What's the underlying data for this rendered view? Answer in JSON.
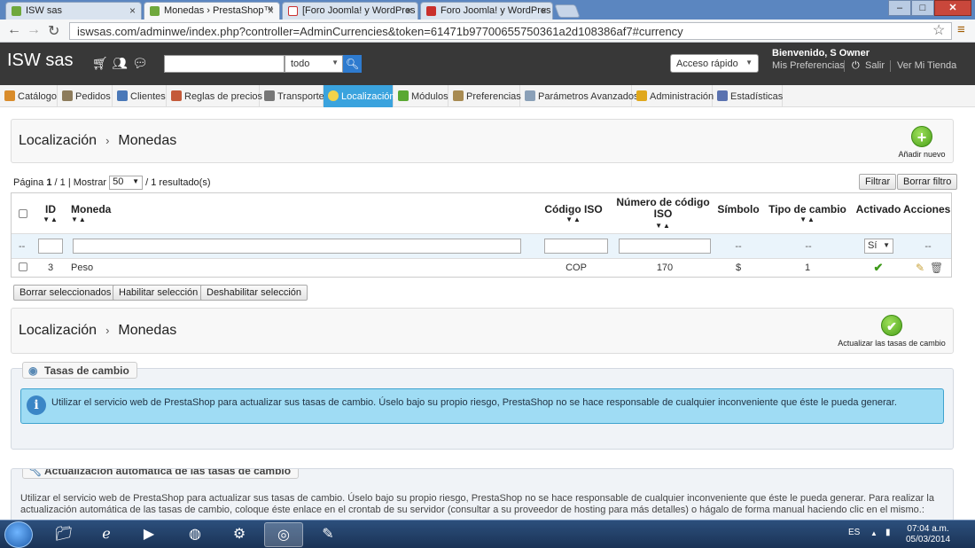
{
  "browser": {
    "tabs": [
      {
        "label": "ISW sas",
        "active": false
      },
      {
        "label": "Monedas › PrestaShop™",
        "active": true
      },
      {
        "label": "[Foro Joomla! y WordPres",
        "active": false
      },
      {
        "label": "Foro Joomla! y WordPres",
        "active": false
      }
    ],
    "window_buttons": {
      "minimize": "–",
      "maximize": "□",
      "close": "✕"
    },
    "url": "iswsas.com/adminwe/index.php?controller=AdminCurrencies&token=61471b97700655750361a2d108386af7#currency",
    "colors": {
      "tabbar": "#5b86c0",
      "accent": "#3aa3de"
    }
  },
  "header": {
    "shop_name": "ISW sas",
    "search_placeholder": "",
    "search_scope": "todo",
    "quick_access": "Acceso rápido",
    "welcome": "Bienvenido, S Owner",
    "prefs_link": "Mis Preferencias",
    "logout_link": "Salir",
    "store_link": "Ver Mi Tienda"
  },
  "menu": {
    "items": [
      {
        "label": "Catálogo",
        "icon": "catalog-icon",
        "color": "#d98c2b"
      },
      {
        "label": "Pedidos",
        "icon": "orders-icon",
        "color": "#8d7c5c"
      },
      {
        "label": "Clientes",
        "icon": "customers-icon",
        "color": "#4a78b8"
      },
      {
        "label": "Reglas de precios",
        "icon": "price-rules-icon",
        "color": "#c45a3a"
      },
      {
        "label": "Transporte",
        "icon": "shipping-icon",
        "color": "#777777"
      },
      {
        "label": "Localización",
        "icon": "localization-icon",
        "color": "#f2d34a"
      },
      {
        "label": "Módulos",
        "icon": "modules-icon",
        "color": "#5aa832"
      },
      {
        "label": "Preferencias",
        "icon": "preferences-icon",
        "color": "#a88b52"
      },
      {
        "label": "Parámetros Avanzados",
        "icon": "advanced-icon",
        "color": "#8aa0b8"
      },
      {
        "label": "Administración",
        "icon": "admin-icon",
        "color": "#e0a81c"
      },
      {
        "label": "Estadísticas",
        "icon": "stats-icon",
        "color": "#5a72b0"
      }
    ]
  },
  "toolbar1": {
    "crumb_1": "Localización",
    "crumb_sep": "›",
    "crumb_2": "Monedas",
    "add_new": "Añadir nuevo"
  },
  "list": {
    "page_label": "Página",
    "page_current": "1",
    "page_total": "/ 1",
    "show_label": "| Mostrar",
    "show_value": "50",
    "results": "/ 1 resultado(s)",
    "filter_btn": "Filtrar",
    "reset_btn": "Borrar filtro",
    "columns": {
      "id": "ID",
      "currency": "Moneda",
      "iso": "Código ISO",
      "iso_num_1": "Número de código",
      "iso_num_2": "ISO",
      "symbol": "Símbolo",
      "rate": "Tipo de cambio",
      "active": "Activado",
      "actions": "Acciones"
    },
    "sort_glyph": "▼▲",
    "filter_placeholders": {
      "dash": "--",
      "active_value": "Sí"
    },
    "rows": [
      {
        "id": "3",
        "name": "Peso",
        "iso": "COP",
        "iso_num": "170",
        "symbol": "$",
        "rate": "1",
        "active": "✔"
      }
    ],
    "bulk": {
      "delete": "Borrar seleccionados",
      "enable": "Habilitar selección",
      "disable": "Deshabilitar selección"
    }
  },
  "toolbar2": {
    "crumb_1": "Localización",
    "crumb_sep": "›",
    "crumb_2": "Monedas",
    "update_rates": "Actualizar las tasas de cambio"
  },
  "exchange": {
    "legend": "Tasas de cambio",
    "info": "Utilizar el servicio web de PrestaShop para actualizar sus tasas de cambio. Úselo bajo su propio riesgo, PrestaShop no se hace responsable de cualquier inconveniente que éste le pueda generar."
  },
  "auto_update": {
    "legend": "Actualización automática de las tasas de cambio",
    "text": "Utilizar el servicio web de PrestaShop para actualizar sus tasas de cambio. Úselo bajo su propio riesgo, PrestaShop no se hace responsable de cualquier inconveniente que éste le pueda generar. Para realizar la actualización automática de las tasas de cambio, coloque éste enlace en el crontab de su servidor (consultar a su proveedor de hosting para más detalles) o hágalo de forma manual haciendo clic en el mismo.:"
  },
  "taskbar": {
    "lang": "ES",
    "time": "07:04 a.m.",
    "date": "05/03/2014"
  }
}
